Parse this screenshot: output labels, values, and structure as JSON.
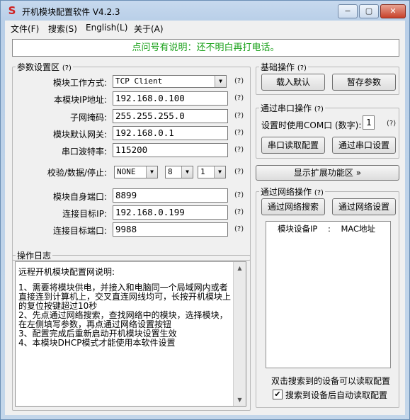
{
  "window": {
    "title": "开机模块配置软件 V4.2.3",
    "controls": {
      "minimize": "−",
      "maximize": "▢",
      "close": "✕"
    }
  },
  "menu": [
    "文件(F)",
    "搜索(S)",
    "English(L)",
    "关于(A)"
  ],
  "banner": "点问号有说明：还不明白再打电话。",
  "params": {
    "legend": "参数设置区",
    "help": "(?)",
    "mode_label": "模块工作方式:",
    "mode_value": "TCP Client",
    "ip_label": "本模块IP地址:",
    "ip_value": "192.168.0.100",
    "mask_label": "子网掩码:",
    "mask_value": "255.255.255.0",
    "gateway_label": "模块默认网关:",
    "gateway_value": "192.168.0.1",
    "baud_label": "串口波特率:",
    "baud_value": "115200",
    "parity_label": "校验/数据/停止:",
    "parity_value": "NONE",
    "databits_value": "8",
    "stopbits_value": "1",
    "local_port_label": "模块自身端口:",
    "local_port_value": "8899",
    "target_ip_label": "连接目标IP:",
    "target_ip_value": "192.168.0.199",
    "target_port_label": "连接目标端口:",
    "target_port_value": "9988"
  },
  "basic": {
    "legend": "基础操作",
    "load_default": "载入默认",
    "save_temp": "暂存参数"
  },
  "serial": {
    "legend": "通过串口操作",
    "com_label": "设置时使用COM口 (数字):",
    "com_value": "1",
    "read_config": "串口读取配置",
    "set_via_serial": "通过串口设置"
  },
  "expand_button": "显示扩展功能区 »",
  "network": {
    "legend": "通过网络操作",
    "search": "通过网络搜索",
    "set_via_network": "通过网络设置",
    "list_header": "模块设备IP    :    MAC地址",
    "hint": "双击搜索到的设备可以读取配置",
    "auto_read_label": "搜索到设备后自动读取配置",
    "auto_read_checked": true
  },
  "log": {
    "legend": "操作日志",
    "title": "远程开机模块配置网说明:",
    "lines": [
      "1、需要将模块供电，并接入和电脑同一个局域网内或者",
      "直接连到计算机上，交叉直连网线均可，长按开机模块上",
      "的复位按键超过10秒",
      "2、先点通过网络搜索，查找网络中的模块，选择模块，",
      "在左侧填写参数，再点通过网络设置按钮",
      "3、配置完成后重新启动开机模块设置生效",
      "4、本模块DHCP模式才能使用本软件设置"
    ]
  }
}
